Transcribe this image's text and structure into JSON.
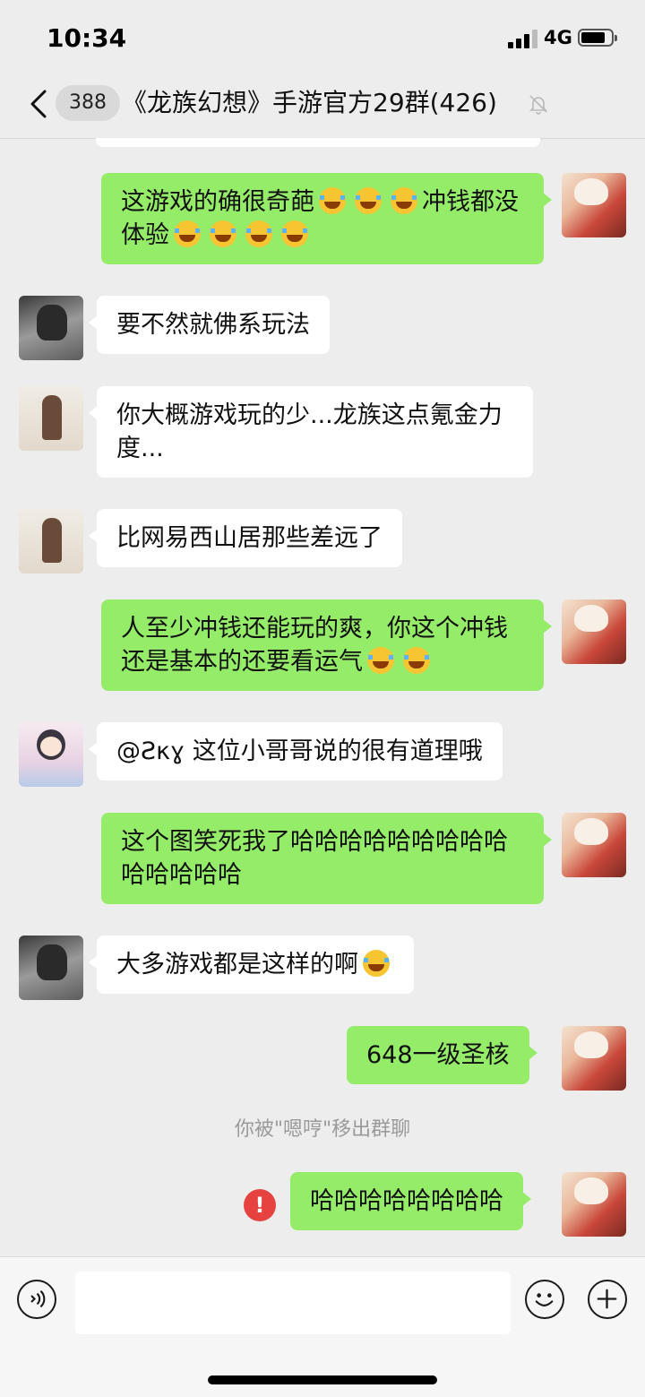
{
  "status_bar": {
    "time": "10:34",
    "network": "4G",
    "battery_level": 0.8
  },
  "header": {
    "unread_count": "388",
    "title": "《龙族幻想》手游官方29群(426)",
    "icons": {
      "back": "chevron-left-icon",
      "mute": "bell-mute-icon"
    }
  },
  "messages": [
    {
      "side": "right",
      "avatar": "me",
      "text": "这游戏的确很奇葩😂😂😂冲钱都没体验😂😂😂😂"
    },
    {
      "side": "left",
      "avatar": "dark",
      "text": "要不然就佛系玩法"
    },
    {
      "side": "left",
      "avatar": "kaws",
      "text": "你大概游戏玩的少...龙族这点氪金力度..."
    },
    {
      "side": "left",
      "avatar": "kaws",
      "text": "比网易西山居那些差远了"
    },
    {
      "side": "right",
      "avatar": "me",
      "text": "人至少冲钱还能玩的爽，你这个冲钱还是基本的还要看运气😂😂"
    },
    {
      "side": "left",
      "avatar": "girl",
      "text": "@Ƨκɣ 这位小哥哥说的很有道理哦"
    },
    {
      "side": "right",
      "avatar": "me",
      "text": "这个图笑死我了哈哈哈哈哈哈哈哈哈哈哈哈哈哈"
    },
    {
      "side": "left",
      "avatar": "dark",
      "text": "大多游戏都是这样的啊😂"
    },
    {
      "side": "right",
      "avatar": "me",
      "text": "648一级圣核"
    },
    {
      "side": "right",
      "avatar": "me",
      "text": "哈哈哈哈哈哈哈哈",
      "failed": true
    }
  ],
  "system_message": "你被\"嗯哼\"移出群聊",
  "failed_marker": "!",
  "input": {
    "placeholder": "",
    "icons": {
      "voice": "voice-icon",
      "emoji": "emoji-smile-icon",
      "more": "plus-icon"
    }
  }
}
